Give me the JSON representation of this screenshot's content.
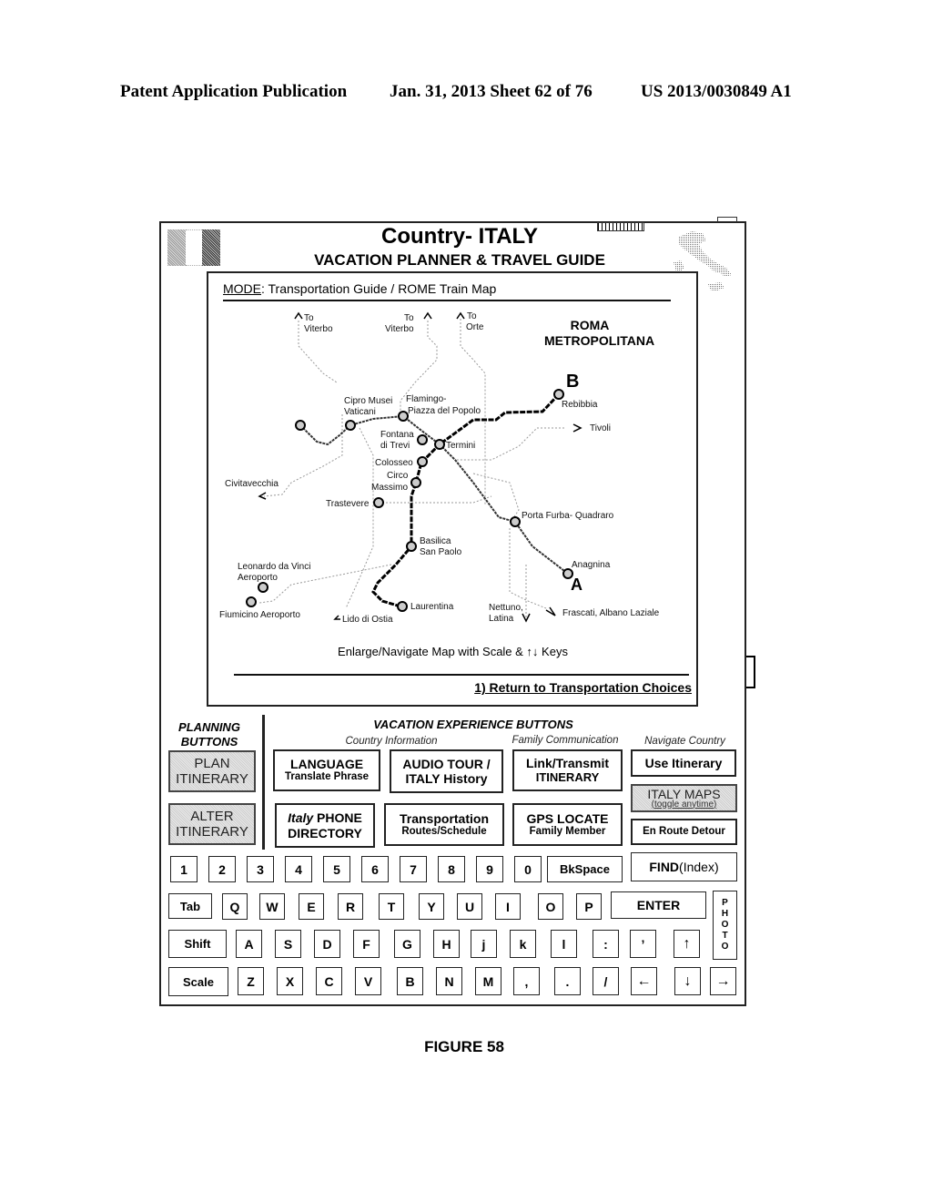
{
  "header": {
    "publication": "Patent Application Publication",
    "date_sheet": "Jan. 31, 2013  Sheet 62 of 76",
    "number": "US 2013/0030849 A1"
  },
  "device": {
    "title": "Country- ITALY",
    "subtitle": "VACATION PLANNER & TRAVEL GUIDE",
    "mode_label": "MODE",
    "mode_value": ": Transportation Guide / ROME Train Map",
    "map": {
      "title_line1": "ROMA",
      "title_line2": "METROPOLITANA",
      "line_b_label": "B",
      "line_a_label": "A",
      "stations": {
        "rebibbia": "Rebibbia",
        "cipro_1": "Cipro Musei",
        "cipro_2": "Vaticani",
        "flaminio_1": "Flamingo-",
        "flaminio_2": "Piazza del Popolo",
        "fontana_1": "Fontana",
        "fontana_2": "di Trevi",
        "termini": "Termini",
        "colosseo": "Colosseo",
        "circo_1": "Circo",
        "circo_2": "Massimo",
        "trastevere": "Trastevere",
        "basilica_1": "Basilica",
        "basilica_2": "San Paolo",
        "porta_furba": "Porta Furba- Quadraro",
        "anagnina": "Anagnina",
        "laurentina": "Laurentina",
        "leonardo_1": "Leonardo da Vinci",
        "leonardo_2": "Aeroporto",
        "fiumicino": "Fiumicino Aeroporto"
      },
      "destinations": {
        "viterbo_a_1": "To",
        "viterbo_a_2": "Viterbo",
        "viterbo_b_1": "To",
        "viterbo_b_2": "Viterbo",
        "orte_1": "To",
        "orte_2": "Orte",
        "tivoli": "Tivoli",
        "civitavecchia": "Civitavecchia",
        "lido": "Lido di Ostia",
        "nettuno_1": "Nettuno,",
        "nettuno_2": "Latina",
        "frascati": "Frascati, Albano Laziale"
      }
    },
    "map_hint": "Enlarge/Navigate Map with Scale & ↑↓ Keys",
    "return_link": "1) Return to Transportation Choices"
  },
  "planning": {
    "heading_1": "PLANNING",
    "heading_2": "BUTTONS",
    "plan_1": "PLAN",
    "plan_2": "ITINERARY",
    "alter_1": "ALTER",
    "alter_2": "ITINERARY"
  },
  "experience": {
    "heading": "VACATION EXPERIENCE BUTTONS",
    "sub_country": "Country Information",
    "sub_family": "Family Communication",
    "sub_navigate": "Navigate Country",
    "language_1": "LANGUAGE",
    "language_2": "Translate Phrase",
    "audio_1": "AUDIO TOUR /",
    "audio_2": "ITALY History",
    "link_1": "Link/Transmit",
    "link_2": "ITINERARY",
    "use_itinerary": "Use Itinerary",
    "phone_italic": "Italy",
    "phone_1": " PHONE",
    "phone_2": "DIRECTORY",
    "transport_1": "Transportation",
    "transport_2": "Routes/Schedule",
    "gps_1": "GPS LOCATE",
    "gps_2": "Family Member",
    "maps_1": "ITALY MAPS",
    "maps_2": "(toggle anytime)",
    "detour": "En Route Detour"
  },
  "keyboard": {
    "row1": [
      "1",
      "2",
      "3",
      "4",
      "5",
      "6",
      "7",
      "8",
      "9",
      "0"
    ],
    "bkspace": "BkSpace",
    "find_bold": "FIND",
    "find_rest": " (Index)",
    "tab": "Tab",
    "row2": [
      "Q",
      "W",
      "E",
      "R",
      "T",
      "Y",
      "U",
      "I",
      "O",
      "P"
    ],
    "enter": "ENTER",
    "photo": [
      "P",
      "H",
      "O",
      "T",
      "O"
    ],
    "shift": "Shift",
    "row3": [
      "A",
      "S",
      "D",
      "F",
      "G",
      "H",
      "j",
      "k",
      "l",
      ":",
      "’",
      "↑"
    ],
    "scale": "Scale",
    "row4": [
      "Z",
      "X",
      "C",
      "V",
      "B",
      "N",
      "M",
      ",",
      ".",
      "/",
      "←",
      "↓",
      "→"
    ]
  },
  "figure_label": "FIGURE 58"
}
